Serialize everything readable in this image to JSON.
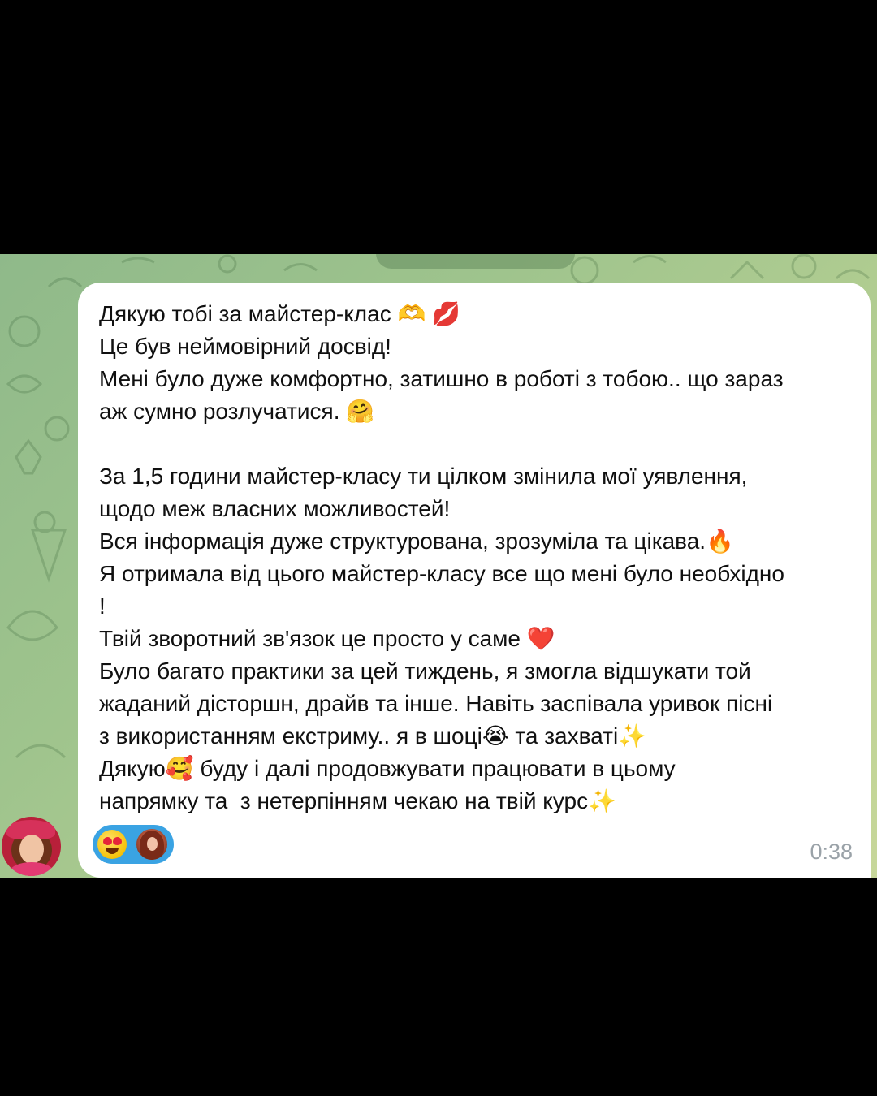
{
  "message": {
    "lines": [
      "Дякую тобі за майстер-клас 🫶 💋",
      "Це був неймовірний досвід!",
      "Мені було дуже комфортно, затишно в роботі з тобою.. що зараз",
      "аж сумно розлучатися. 🤗",
      "",
      "За 1,5 години майстер-класу ти цілком змінила мої уявлення,",
      "щодо меж власних можливостей!",
      "Вся інформація дуже структурована, зрозуміла та цікава.🔥",
      "Я отримала від цього майстер-класу все що мені було необхідно",
      "!",
      "Твій зворотний зв'язок це просто у саме ❤️",
      "Було багато практики за цей тиждень, я змогла відшукати той",
      "жаданий дісторшн, драйв та інше. Навіть заспівала уривок пісні",
      "з використанням екстриму.. я в шоці😭 та захваті✨",
      "Дякую🥰 буду і далі продовжувати працювати в цьому",
      "напрямку та  з нетерпінням чекаю на твій курс✨"
    ],
    "timestamp": "0:38"
  },
  "reaction": {
    "emoji": "heart-eyes-emoji",
    "reactor": "reactor-avatar"
  },
  "sender": {
    "avatar": "sender-avatar"
  },
  "colors": {
    "bubble": "#ffffff",
    "reaction_bg": "#3aa3e3",
    "timestamp": "#9aa2a8",
    "wallpaper_start": "#8fb98a",
    "wallpaper_end": "#c7d79a"
  }
}
